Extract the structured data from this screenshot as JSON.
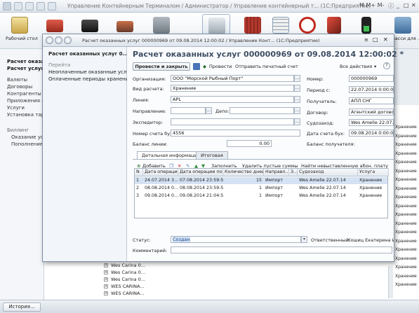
{
  "app": {
    "title": "Управление Контейнерным Терминалом / Администратор / Управление контейнерный т... (1С:Предприятие)",
    "title_right": "M M+ M-"
  },
  "ribbon": [
    {
      "label": "Рабочий стол",
      "icon": "desktop-icon"
    },
    {
      "label": "",
      "icon": "truck-icon"
    },
    {
      "label": "",
      "icon": "locomotive-icon"
    },
    {
      "label": "",
      "icon": "ship-icon"
    },
    {
      "label": "",
      "icon": "factory-icon"
    },
    {
      "label": "",
      "icon": "cash-register-icon"
    },
    {
      "label": "",
      "icon": "container-icon"
    },
    {
      "label": "",
      "icon": "grid-icon"
    },
    {
      "label": "",
      "icon": "stop-sign-icon"
    },
    {
      "label": "",
      "icon": "crane-icon"
    },
    {
      "label": "",
      "icon": "traffic-light-icon"
    },
    {
      "label": "Класси для ...",
      "icon": "classifier-icon"
    }
  ],
  "leftnav": {
    "items": [
      {
        "label": "Расчет оказанн",
        "bold": true
      },
      {
        "label": "Расчет услуг б",
        "bold": true
      },
      {
        "label": "Валюты",
        "bold": false
      },
      {
        "label": "Договоры",
        "bold": false
      },
      {
        "label": "Контрагенты",
        "bold": false
      },
      {
        "label": "Приложения к д",
        "bold": false
      },
      {
        "label": "Услуги",
        "bold": false
      },
      {
        "label": "Установка тариф",
        "bold": false
      },
      {
        "label": "Биллинг",
        "bold": false
      },
      {
        "label": "Оказание услуг",
        "bold": false
      },
      {
        "label": "Пополнение ба",
        "bold": false
      }
    ]
  },
  "bglist": {
    "rows": [
      "Wes Carina 0...",
      "Wes Carina 0...",
      "Wes Carina 0...",
      "WES CARINA...",
      "WES CARINA..."
    ]
  },
  "right_strip": [
    "Хранение",
    "Хранение",
    "Хранение",
    "Хранение",
    "Хранение",
    "Хранение",
    "Хранение",
    "Хранение",
    "Хранение",
    "Хранение",
    "Хранение",
    "Хранение",
    "Хранение",
    "Хранение",
    "Хранение",
    "Хранение",
    "Хранение",
    "Хранение",
    "Хранение"
  ],
  "taskbar": {
    "history": "История..."
  },
  "dialog": {
    "window_title": "Расчет оказанных услуг 000000969 от 09.08.2014 12:00:02 / Управление Конт... (1С:Предприятие)",
    "side": {
      "current": "Расчет оказанных услуг 0...",
      "go_to": "Перейти",
      "links": [
        "Неоплаченные оказанные услуги",
        "Оплаченные периоды хранения"
      ]
    },
    "heading": "Расчет оказанных услуг 000000969 от 09.08.2014 12:00:02 *",
    "toolbar": {
      "post_close": "Провести и закрыть",
      "post": "Провести",
      "print": "Отправить печатный счет",
      "actions": "Все действия"
    },
    "fields": {
      "org_label": "Организация:",
      "org_value": "ООО \"Морской Рыбный Порт\"",
      "calc_label": "Вид расчета:",
      "calc_value": "Хранение",
      "line_label": "Линия:",
      "line_value": "APL",
      "dir_label": "Направление:",
      "dir_value": "",
      "depot_label": "Депо:",
      "depot_value": "",
      "fwd_label": "Экспедитор:",
      "fwd_value": "",
      "acct_label": "Номер счета бух:",
      "acct_value": "4556",
      "bal_label": "Баланс линии:",
      "bal_value": "0.00",
      "num_label": "Номер:",
      "num_value": "000000969",
      "period_label": "Период с:",
      "period_value": "22.07.2014  0:00:00",
      "recv_label": "Получатель:",
      "recv_value": "АПЛ СНГ",
      "contract_label": "Договор:",
      "contract_value": "Агентский договор",
      "vessel_label": "Судозаход:",
      "vessel_value": "Wes Amelie 22.07.14",
      "date_label": "Дата счета бух:",
      "date_value": "09.08.2014  0:00:00",
      "recv_bal_label": "Баланс получателя:",
      "recv_bal_value": ""
    },
    "tabs": [
      "Детальная информация",
      "Итоговая"
    ],
    "table_toolbar": {
      "add": "Добавить",
      "fill": "Заполнить",
      "delete_empty": "Удалить пустые суммы",
      "find_unissued": "Найти невыставленную абон. плату"
    },
    "table": {
      "columns": [
        "N",
        "Дата операции",
        "Дата операции по",
        "Количество дней",
        "Направл...",
        "З...",
        "Судозаход",
        "Услуга"
      ],
      "rows": [
        [
          "1",
          "24.07.2014 3...",
          "07.08.2014 23:59:59",
          "15",
          "Импорт",
          "",
          "Wes Amelie 22.07.14",
          "Хранение"
        ],
        [
          "2",
          "08.08.2014 0...",
          "08.08.2014 23:59:59",
          "1",
          "Импорт",
          "",
          "Wes Amelie 22.07.14",
          "Хранение"
        ],
        [
          "3",
          "09.08.2014 0...",
          "09.08.2014 21:04:50",
          "1",
          "Импорт",
          "",
          "Wes Amelie 22.07.14",
          "Хранение"
        ]
      ]
    },
    "status_label": "Статус:",
    "status_value": "Создан",
    "responsible_label": "Ответственный:",
    "responsible_value": "Кошиц Екатерина Ив...",
    "comment_label": "Комментарий:",
    "comment_value": ""
  }
}
